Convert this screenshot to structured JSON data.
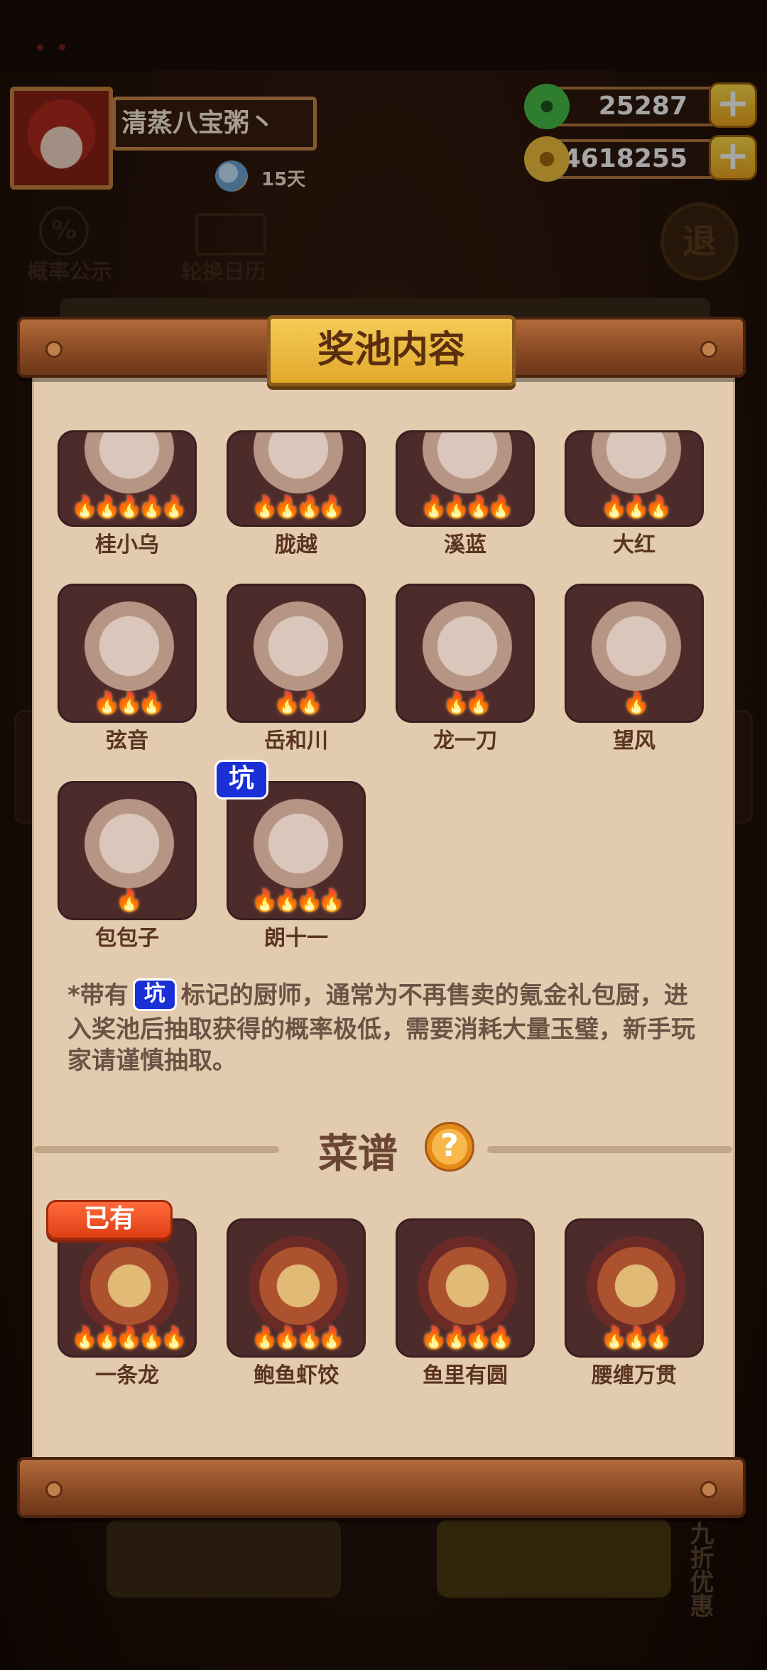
{
  "header": {
    "player_name": "清蒸八宝粥丶",
    "days_text": "15天",
    "jade_amount": "25287",
    "coin_amount": "74618255",
    "plus_symbol": "+"
  },
  "background": {
    "rate_label": "概率公示",
    "calendar_label": "轮换日历",
    "pct_symbol": "%",
    "exit_symbol": "退",
    "discount_label": "九折优惠"
  },
  "panel": {
    "title": "奖池内容",
    "chefs": [
      {
        "name": "桂小乌",
        "stars": 5
      },
      {
        "name": "胧越",
        "stars": 4
      },
      {
        "name": "溪蓝",
        "stars": 4
      },
      {
        "name": "大红",
        "stars": 3
      },
      {
        "name": "弦音",
        "stars": 3
      },
      {
        "name": "岳和川",
        "stars": 2
      },
      {
        "name": "龙一刀",
        "stars": 2
      },
      {
        "name": "望风",
        "stars": 1
      },
      {
        "name": "包包子",
        "stars": 1
      },
      {
        "name": "朗十一",
        "stars": 4
      }
    ],
    "pit_badge": "坑",
    "note_prefix": "*带有",
    "note_badge": "坑",
    "note_body": "标记的厨师，通常为不再售卖的氪金礼包厨，进入奖池后抽取获得的概率极低，需要消耗大量玉璧，新手玩家请谨慎抽取。",
    "recipe_title": "菜谱",
    "help_symbol": "?",
    "owned_label": "已有",
    "dishes": [
      {
        "name": "一条龙",
        "stars": 5
      },
      {
        "name": "鲍鱼虾饺",
        "stars": 4
      },
      {
        "name": "鱼里有圆",
        "stars": 4
      },
      {
        "name": "腰缠万贯",
        "stars": 3
      }
    ]
  },
  "colors": {
    "paper": "#e3cbb0",
    "card": "#4d2b2b",
    "pit_badge": "#1a2fd6",
    "owned_badge": "#e03e16",
    "title_plaque": "#f4cb55"
  }
}
